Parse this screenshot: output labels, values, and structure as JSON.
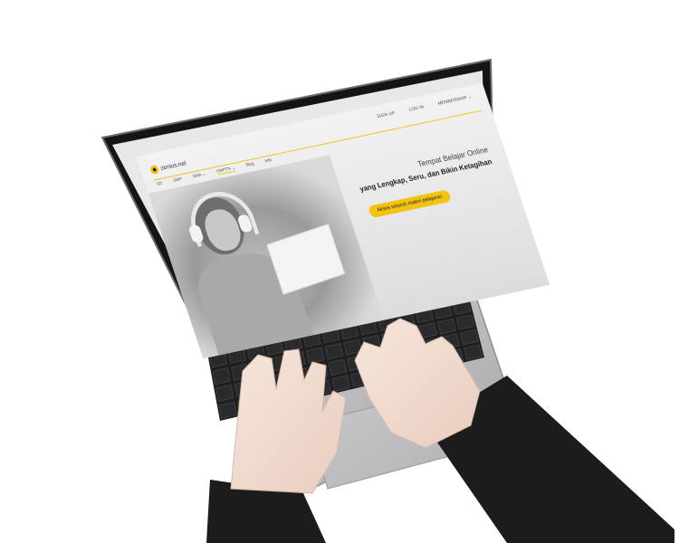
{
  "website": {
    "logo_text": "zenius.net",
    "top_nav": [
      "SIGN UP",
      "LOG IN",
      "MEMBERSHIP ⌄"
    ],
    "main_nav": [
      "SD",
      "SMP",
      "SMA ⌄",
      "UMPTN ⌄",
      "Blog",
      "Info"
    ],
    "hero_line1": "Tempat Belajar Online",
    "hero_line2": "yang Lengkap, Seru, dan Bikin Ketagihan",
    "cta_label": "Akses seluruh materi pelajaran"
  },
  "colors": {
    "accent": "#f2c40f",
    "laptop_body": "#b9b9bb",
    "bezel": "#1a1a1a",
    "sleeve": "#1c1c1c",
    "skin": "#f1ddd2"
  }
}
